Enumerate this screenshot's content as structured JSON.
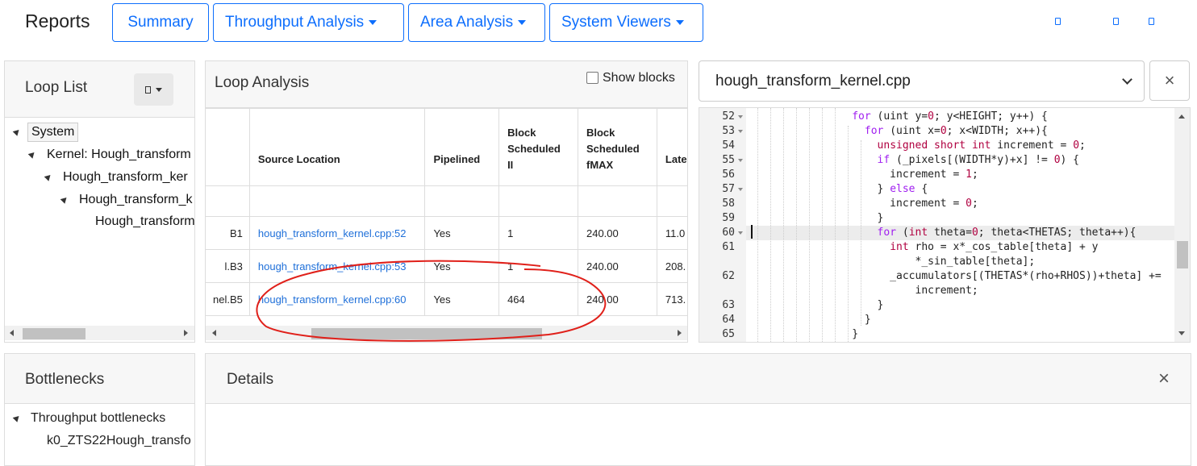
{
  "navbar": {
    "brand": "Reports",
    "buttons": [
      "Summary",
      "Throughput Analysis",
      "Area Analysis",
      "System Viewers"
    ]
  },
  "loop_list": {
    "title": "Loop List",
    "tree": [
      "System",
      "Kernel: Hough_transform",
      "Hough_transform_ker",
      "Hough_transform_k",
      "Hough_transform"
    ]
  },
  "loop_analysis": {
    "title": "Loop Analysis",
    "show_blocks_label": "Show blocks",
    "headers": [
      "Source Location",
      "Pipelined",
      "Block Scheduled II",
      "Block Scheduled fMAX",
      "Late"
    ],
    "header_lines": {
      "source": "Source Location",
      "pipelined": "Pipelined",
      "ii": [
        "Block",
        "Scheduled",
        "II"
      ],
      "fmax": [
        "Block",
        "Scheduled",
        "fMAX"
      ],
      "late": "Late"
    },
    "rows": [
      {
        "name": "B1",
        "source": "hough_transform_kernel.cpp:52",
        "pipelined": "Yes",
        "ii": "1",
        "fmax": "240.00",
        "late": "11.0"
      },
      {
        "name": "l.B3",
        "source": "hough_transform_kernel.cpp:53",
        "pipelined": "Yes",
        "ii": "1",
        "fmax": "240.00",
        "late": "208."
      },
      {
        "name": "nel.B5",
        "source": "hough_transform_kernel.cpp:60",
        "pipelined": "Yes",
        "ii": "464",
        "fmax": "240.00",
        "late": "713."
      }
    ]
  },
  "editor": {
    "file": "hough_transform_kernel.cpp",
    "close": "×",
    "lines": [
      {
        "n": "52",
        "fold": true
      },
      {
        "n": "53",
        "fold": true
      },
      {
        "n": "54",
        "fold": false
      },
      {
        "n": "55",
        "fold": true
      },
      {
        "n": "56",
        "fold": false
      },
      {
        "n": "57",
        "fold": true
      },
      {
        "n": "58",
        "fold": false
      },
      {
        "n": "59",
        "fold": false
      },
      {
        "n": "60",
        "fold": true
      },
      {
        "n": "61",
        "fold": false
      },
      {
        "n": "",
        "fold": false
      },
      {
        "n": "62",
        "fold": false
      },
      {
        "n": "",
        "fold": false
      },
      {
        "n": "63",
        "fold": false
      },
      {
        "n": "64",
        "fold": false
      },
      {
        "n": "65",
        "fold": false
      }
    ]
  },
  "bottlenecks": {
    "title": "Bottlenecks",
    "items": [
      "Throughput bottlenecks",
      "k0_ZTS22Hough_transfo"
    ]
  },
  "details": {
    "title": "Details",
    "close": "×"
  },
  "colors": {
    "accent": "#0d6efd",
    "link": "#1e6fd9",
    "annotation": "#e0201a"
  }
}
